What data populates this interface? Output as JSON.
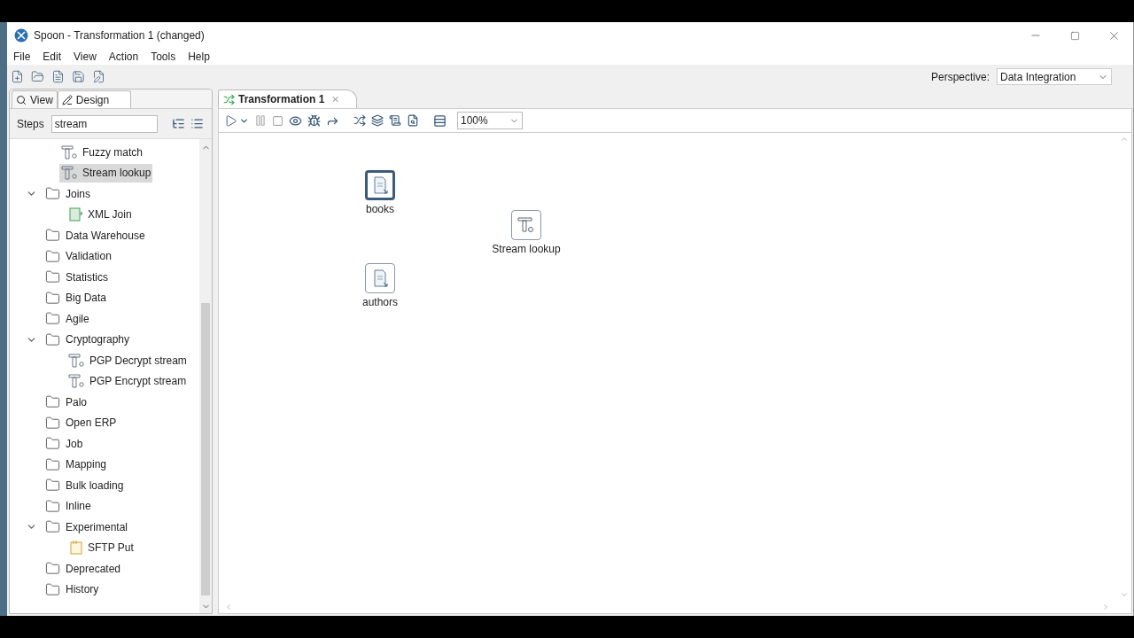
{
  "window": {
    "title": "Spoon - Transformation 1 (changed)"
  },
  "menu": [
    "File",
    "Edit",
    "View",
    "Action",
    "Tools",
    "Help"
  ],
  "perspective": {
    "label": "Perspective:",
    "value": "Data Integration"
  },
  "left_tabs": [
    {
      "label": "View",
      "selected": false
    },
    {
      "label": "Design",
      "selected": true
    }
  ],
  "steps_filter": {
    "label": "Steps",
    "value": "stream"
  },
  "tree": {
    "orphan_steps": [
      {
        "label": "Fuzzy match",
        "kind": "step",
        "selected": false
      },
      {
        "label": "Stream lookup",
        "kind": "step",
        "selected": true
      }
    ],
    "items": [
      {
        "label": "Joins",
        "expanded": true,
        "children": [
          {
            "label": "XML Join",
            "kind": "xml",
            "selected": false
          }
        ]
      },
      {
        "label": "Data Warehouse",
        "expanded": false
      },
      {
        "label": "Validation",
        "expanded": false
      },
      {
        "label": "Statistics",
        "expanded": false
      },
      {
        "label": "Big Data",
        "expanded": false
      },
      {
        "label": "Agile",
        "expanded": false
      },
      {
        "label": "Cryptography",
        "expanded": true,
        "children": [
          {
            "label": "PGP Decrypt stream",
            "kind": "step",
            "selected": false
          },
          {
            "label": "PGP Encrypt stream",
            "kind": "step",
            "selected": false
          }
        ]
      },
      {
        "label": "Palo",
        "expanded": false
      },
      {
        "label": "Open ERP",
        "expanded": false
      },
      {
        "label": "Job",
        "expanded": false
      },
      {
        "label": "Mapping",
        "expanded": false
      },
      {
        "label": "Bulk loading",
        "expanded": false
      },
      {
        "label": "Inline",
        "expanded": false
      },
      {
        "label": "Experimental",
        "expanded": true,
        "children": [
          {
            "label": "SFTP Put",
            "kind": "sftp",
            "selected": false
          }
        ]
      },
      {
        "label": "Deprecated",
        "expanded": false
      },
      {
        "label": "History",
        "expanded": false
      }
    ]
  },
  "editor_tab": {
    "label": "Transformation 1",
    "close": "⨯"
  },
  "zoom": "100%",
  "canvas_nodes": [
    {
      "label": "books",
      "kind": "input",
      "selected": true
    },
    {
      "label": "Stream lookup",
      "kind": "lookup",
      "selected": false
    },
    {
      "label": "authors",
      "kind": "input",
      "selected": false
    }
  ]
}
